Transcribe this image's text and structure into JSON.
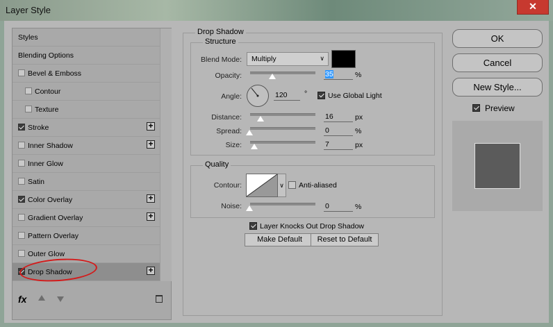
{
  "window": {
    "title": "Layer Style",
    "close_label": "✕"
  },
  "styles_list": [
    {
      "label": "Styles",
      "has_checkbox": false,
      "checked": false,
      "plus": false,
      "indent": 0
    },
    {
      "label": "Blending Options",
      "has_checkbox": false,
      "checked": false,
      "plus": false,
      "indent": 0
    },
    {
      "label": "Bevel & Emboss",
      "has_checkbox": true,
      "checked": false,
      "plus": false,
      "indent": 0
    },
    {
      "label": "Contour",
      "has_checkbox": true,
      "checked": false,
      "plus": false,
      "indent": 1
    },
    {
      "label": "Texture",
      "has_checkbox": true,
      "checked": false,
      "plus": false,
      "indent": 1
    },
    {
      "label": "Stroke",
      "has_checkbox": true,
      "checked": true,
      "plus": true,
      "indent": 0
    },
    {
      "label": "Inner Shadow",
      "has_checkbox": true,
      "checked": false,
      "plus": true,
      "indent": 0
    },
    {
      "label": "Inner Glow",
      "has_checkbox": true,
      "checked": false,
      "plus": false,
      "indent": 0
    },
    {
      "label": "Satin",
      "has_checkbox": true,
      "checked": false,
      "plus": false,
      "indent": 0
    },
    {
      "label": "Color Overlay",
      "has_checkbox": true,
      "checked": true,
      "plus": true,
      "indent": 0
    },
    {
      "label": "Gradient Overlay",
      "has_checkbox": true,
      "checked": false,
      "plus": true,
      "indent": 0
    },
    {
      "label": "Pattern Overlay",
      "has_checkbox": true,
      "checked": false,
      "plus": false,
      "indent": 0
    },
    {
      "label": "Outer Glow",
      "has_checkbox": true,
      "checked": false,
      "plus": false,
      "indent": 0
    },
    {
      "label": "Drop Shadow",
      "has_checkbox": true,
      "checked": true,
      "plus": true,
      "indent": 0,
      "selected": true
    }
  ],
  "bottom_toolbar": {
    "fx_label": "fx"
  },
  "drop_shadow": {
    "section_title": "Drop Shadow",
    "structure": {
      "title": "Structure",
      "blend_mode_label": "Blend Mode:",
      "blend_mode_value": "Multiply",
      "shadow_color": "#000000",
      "opacity_label": "Opacity:",
      "opacity_value": "35",
      "opacity_unit": "%",
      "angle_label": "Angle:",
      "angle_value": "120",
      "angle_unit": "°",
      "use_global_light_label": "Use Global Light",
      "use_global_light": true,
      "distance_label": "Distance:",
      "distance_value": "16",
      "distance_unit": "px",
      "spread_label": "Spread:",
      "spread_value": "0",
      "spread_unit": "%",
      "size_label": "Size:",
      "size_value": "7",
      "size_unit": "px"
    },
    "quality": {
      "title": "Quality",
      "contour_label": "Contour:",
      "anti_aliased_label": "Anti-aliased",
      "anti_aliased": false,
      "noise_label": "Noise:",
      "noise_value": "0",
      "noise_unit": "%"
    },
    "layer_knocks_out_label": "Layer Knocks Out Drop Shadow",
    "layer_knocks_out": true,
    "make_default_label": "Make Default",
    "reset_default_label": "Reset to Default"
  },
  "right_panel": {
    "ok_label": "OK",
    "cancel_label": "Cancel",
    "new_style_label": "New Style...",
    "preview_label": "Preview",
    "preview_checked": true
  },
  "colors": {
    "accent_highlight": "#3399ff",
    "annotation_circle": "#d41a1a"
  }
}
